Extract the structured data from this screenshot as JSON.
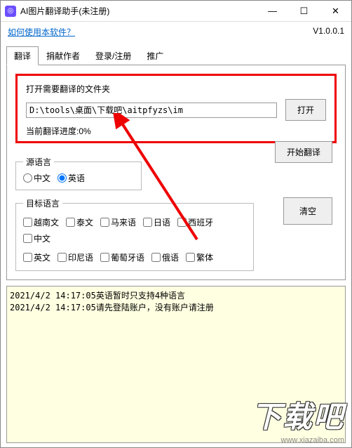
{
  "window": {
    "title": "AI图片翻译助手(未注册)",
    "help_link": "如何使用本软件？",
    "version": "V1.0.0.1"
  },
  "tabs": {
    "items": [
      "翻译",
      "捐献作者",
      "登录/注册",
      "推广"
    ]
  },
  "folder": {
    "label": "打开需要翻译的文件夹",
    "path": "D:\\tools\\桌面\\下载吧\\aitpfyzs\\im",
    "open_btn": "打开",
    "progress": "当前翻译进度:0%"
  },
  "source_lang": {
    "legend": "源语言",
    "options": [
      "中文",
      "英语"
    ],
    "selected": 1
  },
  "start_btn": "开始翻译",
  "target_lang": {
    "legend": "目标语言",
    "row1": [
      "越南文",
      "泰文",
      "马来语",
      "日语",
      "西班牙",
      "中文"
    ],
    "row2": [
      "英文",
      "印尼语",
      "葡萄牙语",
      "俄语",
      "繁体"
    ]
  },
  "clear_btn": "清空",
  "log": {
    "lines": [
      "2021/4/2 14:17:05英语暂时只支持4种语言",
      "2021/4/2 14:17:05请先登陆账户，没有账户请注册"
    ]
  },
  "watermark": {
    "big": "下载吧",
    "url": "www.xiazaiba.com"
  }
}
